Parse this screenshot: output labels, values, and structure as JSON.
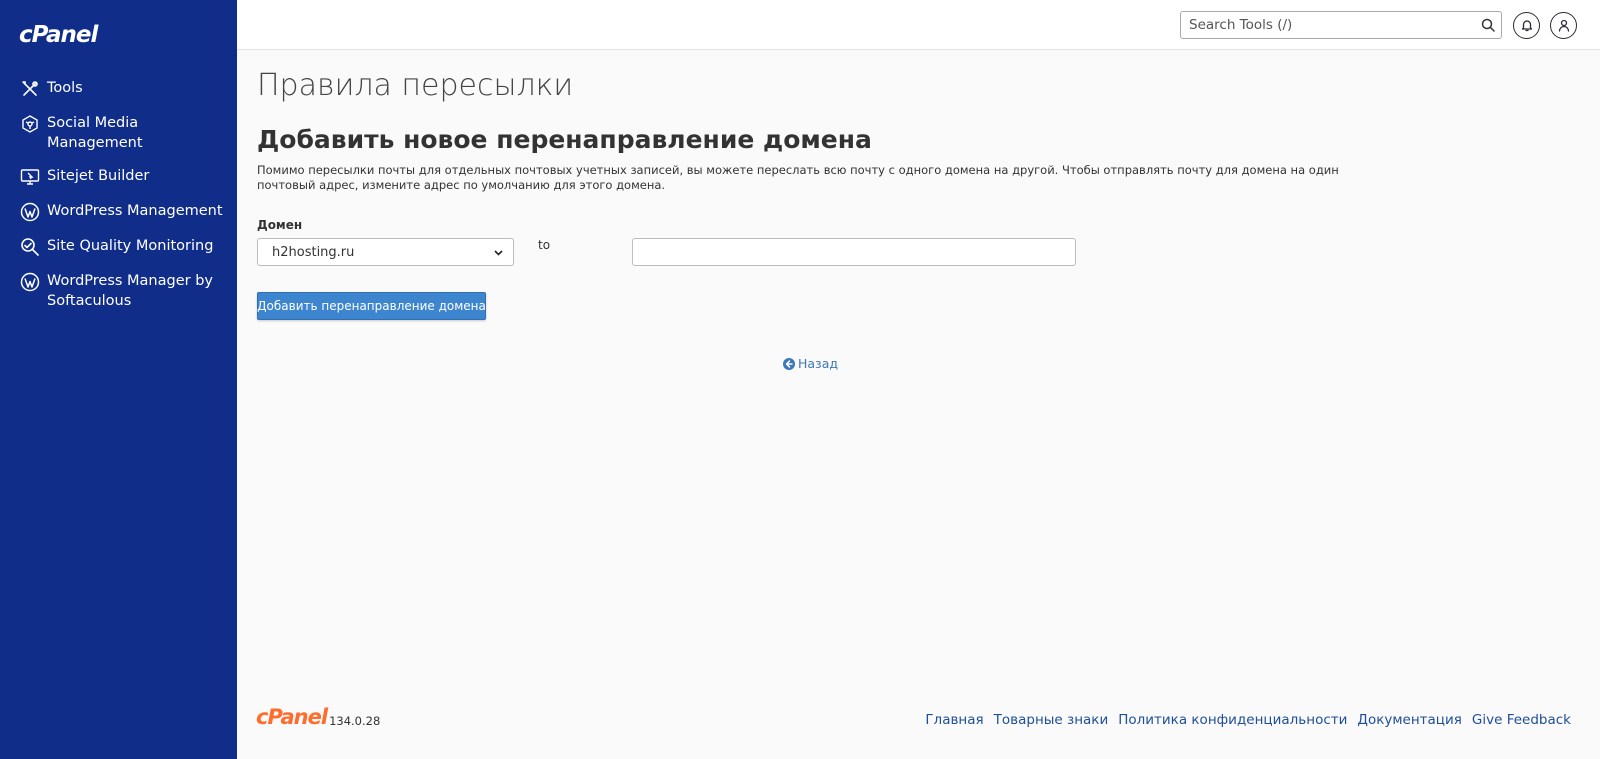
{
  "sidebar": {
    "logo": "cPanel",
    "items": [
      {
        "label": "Tools",
        "icon": "tools-icon"
      },
      {
        "label": "Social Media Management",
        "icon": "social-media-icon"
      },
      {
        "label": "Sitejet Builder",
        "icon": "sitejet-icon"
      },
      {
        "label": "WordPress Management",
        "icon": "wordpress-icon"
      },
      {
        "label": "Site Quality Monitoring",
        "icon": "site-quality-icon"
      },
      {
        "label": "WordPress Manager by Softaculous",
        "icon": "wordpress-icon"
      }
    ]
  },
  "header": {
    "search_placeholder": "Search Tools (/)"
  },
  "main": {
    "page_title": "Правила пересылки",
    "section_title": "Добавить новое перенаправление домена",
    "description": "Помимо пересылки почты для отдельных почтовых учетных записей, вы можете переслать всю почту с одного домена на другой. Чтобы отправлять почту для домена на один почтовый адрес, измените адрес по умолчанию для этого домена.",
    "domain_label": "Домен",
    "domain_selected": "h2hosting.ru",
    "to_label": "to",
    "target_value": "",
    "submit_label": "Добавить перенаправление домена",
    "back_label": "Назад"
  },
  "footer": {
    "logo": "cPanel",
    "version": "134.0.28",
    "links": [
      "Главная",
      "Товарные знаки",
      "Политика конфиденциальности",
      "Документация",
      "Give Feedback"
    ]
  },
  "colors": {
    "sidebar_bg": "#0f2d89",
    "primary_button": "#3d86cf",
    "link": "#1f4e9a",
    "brand_orange": "#ff6c2c"
  }
}
